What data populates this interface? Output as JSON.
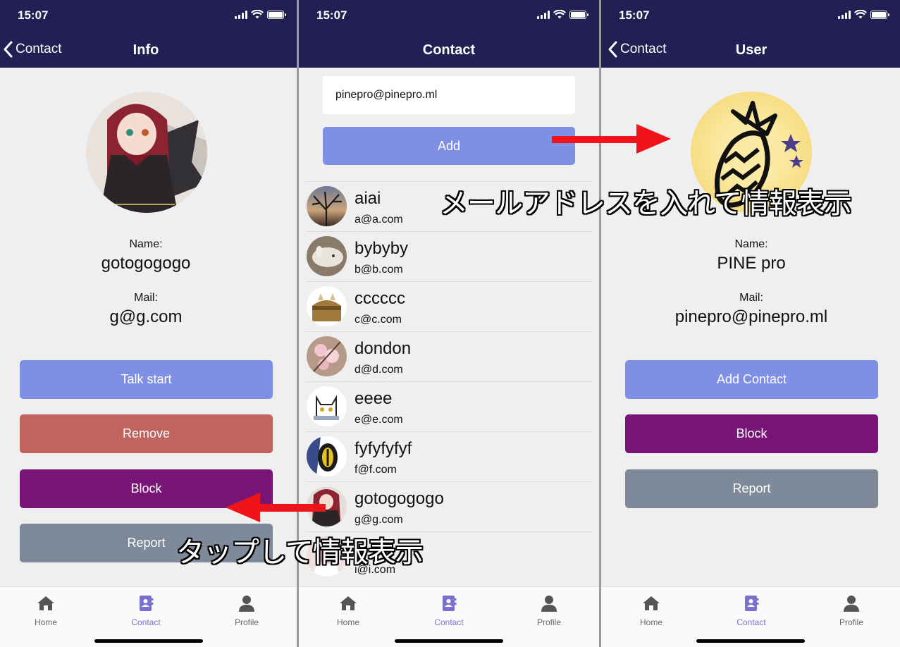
{
  "status": {
    "time": "15:07"
  },
  "colors": {
    "nav": "#221f55",
    "primary": "#7f8fe4",
    "remove": "#c0645f",
    "block": "#771677",
    "report": "#7e8a99",
    "active_tab": "#7a71cf"
  },
  "tabs": [
    {
      "label": "Home",
      "icon": "home-icon"
    },
    {
      "label": "Contact",
      "icon": "contact-book-icon"
    },
    {
      "label": "Profile",
      "icon": "person-icon"
    }
  ],
  "info_screen": {
    "back_label": "Contact",
    "title": "Info",
    "name_label": "Name:",
    "name": "gotogogogo",
    "mail_label": "Mail:",
    "mail": "g@g.com",
    "buttons": {
      "talk": "Talk start",
      "remove": "Remove",
      "block": "Block",
      "report": "Report"
    }
  },
  "contact_screen": {
    "title": "Contact",
    "email_input_value": "pinepro@pinepro.ml",
    "add_label": "Add",
    "contacts": [
      {
        "name": "aiai",
        "email": "a@a.com"
      },
      {
        "name": "bybyby",
        "email": "b@b.com"
      },
      {
        "name": "cccccc",
        "email": "c@c.com"
      },
      {
        "name": "dondon",
        "email": "d@d.com"
      },
      {
        "name": "eeee",
        "email": "e@e.com"
      },
      {
        "name": "fyfyfyfyf",
        "email": "f@f.com"
      },
      {
        "name": "gotogogogo",
        "email": "g@g.com"
      },
      {
        "name": "",
        "email": "i@i.com"
      }
    ]
  },
  "user_screen": {
    "back_label": "Contact",
    "title": "User",
    "name_label": "Name:",
    "name": "PINE pro",
    "mail_label": "Mail:",
    "mail": "pinepro@pinepro.ml",
    "buttons": {
      "add_contact": "Add Contact",
      "block": "Block",
      "report": "Report"
    }
  },
  "annotations": {
    "email_caption": "メールアドレスを入れて情報表示",
    "tap_caption": "タップして情報表示"
  }
}
